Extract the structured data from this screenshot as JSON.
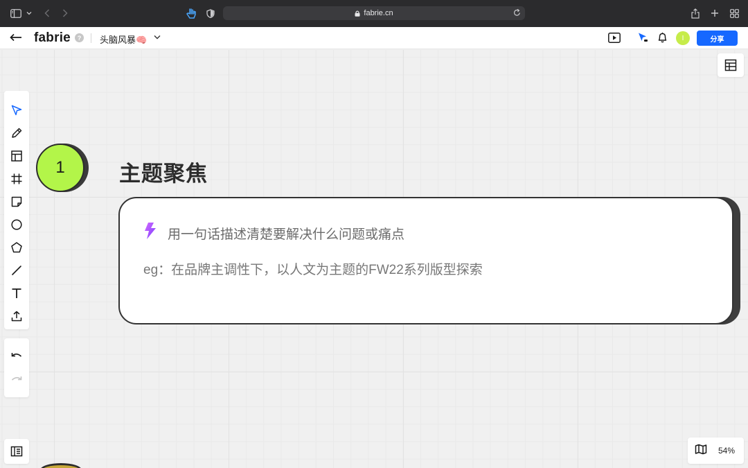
{
  "browser": {
    "url": "fabrie.cn"
  },
  "header": {
    "logo": "fabrie",
    "help": "?",
    "board_title": "头脑风暴🧠",
    "avatar_initial": "I",
    "share_label": "分享"
  },
  "board": {
    "step_number": "1",
    "section_title": "主题聚焦",
    "prompt": "用一句话描述清楚要解决什么问题或痛点",
    "example": "eg：在品牌主调性下，以人文为主题的FW22系列版型探索"
  },
  "zoom": {
    "level": "54%"
  },
  "icons": {
    "sidebar": "sidebar-icon",
    "back": "arrow-left-icon",
    "present": "present-icon",
    "cursor": "cursor-icon",
    "bell": "bell-icon",
    "map": "map-icon",
    "table": "table-icon",
    "bolt": "bolt-icon"
  },
  "colors": {
    "accent": "#1668ff",
    "step_circle": "#b3f549",
    "avatar": "#c6ec4a"
  }
}
